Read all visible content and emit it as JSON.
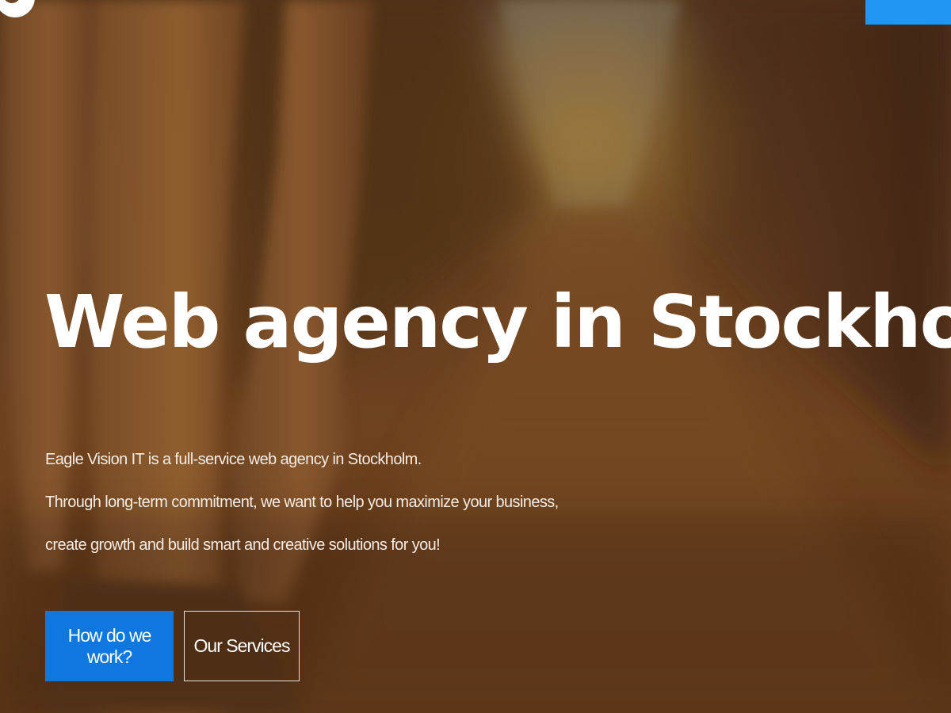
{
  "hero": {
    "title": "Web agency in Stockholm",
    "intro": [
      "Eagle Vision IT is a full-service web agency in Stockholm.",
      "Through long-term commitment, we want to help you maximize your business,",
      "create growth and build smart and creative solutions for you!"
    ],
    "buttons": {
      "primary_label": "How do we work?",
      "secondary_label": "Our Services"
    }
  },
  "header": {
    "logo_icon": "logo-mark-icon",
    "cta_label": ""
  },
  "colors": {
    "accent_blue": "#0f78e0",
    "header_button_blue": "#2196f3",
    "overlay_brown": "#5a3416",
    "text_white": "#ffffff"
  }
}
